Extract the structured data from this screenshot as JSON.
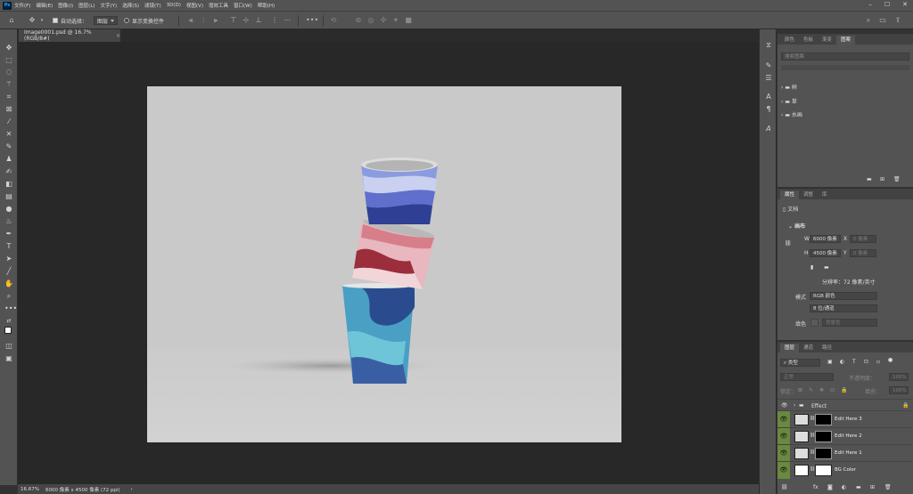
{
  "menubar": {
    "app_icon": "Ps",
    "items": [
      "文件(F)",
      "编辑(E)",
      "图像(I)",
      "图层(L)",
      "文字(Y)",
      "选择(S)",
      "滤镜(T)",
      "3D(D)",
      "视图(V)",
      "增效工具",
      "窗口(W)",
      "帮助(H)"
    ],
    "window_controls": [
      "minimize-icon",
      "maximize-icon",
      "close-icon"
    ]
  },
  "options": {
    "auto_select_label": "自动选择：",
    "auto_select_value": "图层",
    "transform_label": "显示变换控件"
  },
  "document": {
    "tab_title": "Image0001.psd @ 16.7%(RGB/8#)",
    "close": "×"
  },
  "status": {
    "zoom": "16.67%",
    "info": "6000 像素 x 4500 像素 (72 ppi)",
    "arrow": "›"
  },
  "swatches_panel": {
    "tabs": [
      "颜色",
      "色板",
      "渐变",
      "图案"
    ],
    "search_placeholder": "搜索图案",
    "groups": [
      "树",
      "草",
      "水画"
    ]
  },
  "properties_panel": {
    "tabs": [
      "属性",
      "调整",
      "库"
    ],
    "doc_label": "文档",
    "section": "画布",
    "w_label": "W",
    "w_value": "6000 像素",
    "x_label": "X",
    "x_value": "0 像素",
    "h_label": "H",
    "h_value": "4500 像素",
    "y_label": "Y",
    "y_value": "0 像素",
    "resolution": "分辨率：72 像素/英寸",
    "mode_label": "模式",
    "mode_value": "RGB 颜色",
    "depth_value": "8 位/通道",
    "fill_label": "填色",
    "fill_value": "背景色"
  },
  "layers_panel": {
    "tabs": [
      "图层",
      "通道",
      "路径"
    ],
    "filter_value": "类型",
    "blend_mode": "正常",
    "opacity_label": "不透明度：",
    "opacity_value": "100%",
    "lock_label": "锁定：",
    "fill_label": "填充：",
    "fill_value": "100%",
    "group_name": "Effect",
    "layers": [
      {
        "name": "Edit Here 3"
      },
      {
        "name": "Edit Here 2"
      },
      {
        "name": "Edit Here 1"
      },
      {
        "name": "BG Color"
      }
    ]
  },
  "colors": {
    "accent_eye": "#68893f",
    "panel_bg": "#535353",
    "canvas_bg": "#282828"
  }
}
